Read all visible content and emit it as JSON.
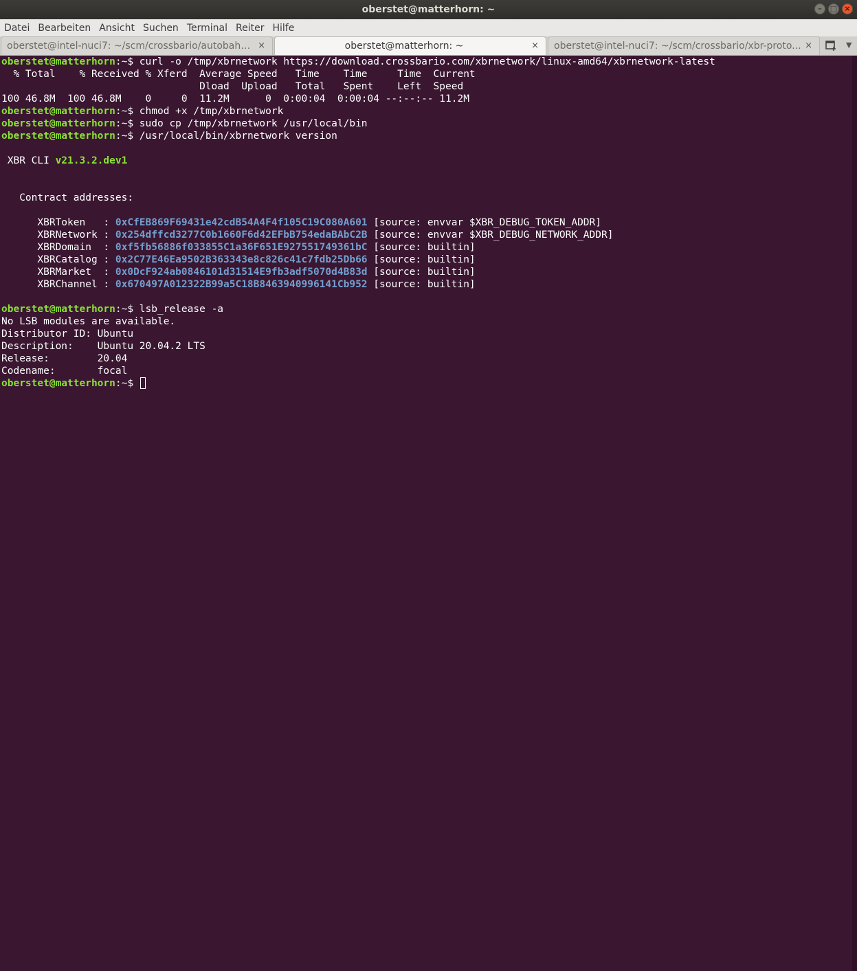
{
  "window": {
    "title": "oberstet@matterhorn: ~"
  },
  "menu": [
    "Datei",
    "Bearbeiten",
    "Ansicht",
    "Suchen",
    "Terminal",
    "Reiter",
    "Hilfe"
  ],
  "tabs": [
    {
      "label": "oberstet@intel-nuci7: ~/scm/crossbario/autobahn-...",
      "active": false
    },
    {
      "label": "oberstet@matterhorn: ~",
      "active": true
    },
    {
      "label": "oberstet@intel-nuci7: ~/scm/crossbario/xbr-proto...",
      "active": false
    }
  ],
  "prompt": {
    "user_host": "oberstet@matterhorn",
    "path_sym": ":~$"
  },
  "terminal": {
    "cmd1": " curl -o /tmp/xbrnetwork https://download.crossbario.com/xbrnetwork/linux-amd64/xbrnetwork-latest",
    "curl_h1": "  % Total    % Received % Xferd  Average Speed   Time    Time     Time  Current",
    "curl_h2": "                                 Dload  Upload   Total   Spent    Left  Speed",
    "curl_row": "100 46.8M  100 46.8M    0     0  11.2M      0  0:00:04  0:00:04 --:--:-- 11.2M",
    "cmd2": " chmod +x /tmp/xbrnetwork",
    "cmd3": " sudo cp /tmp/xbrnetwork /usr/local/bin",
    "cmd4": " /usr/local/bin/xbrnetwork version",
    "cli_prefix": " XBR CLI ",
    "cli_version": "v21.3.2.dev1",
    "contract_header": "   Contract addresses:",
    "contracts": [
      {
        "name": "      XBRToken   : ",
        "address": "0xCfEB869F69431e42cdB54A4F4f105C19C080A601",
        "source": " [source: envvar $XBR_DEBUG_TOKEN_ADDR]"
      },
      {
        "name": "      XBRNetwork : ",
        "address": "0x254dffcd3277C0b1660F6d42EFbB754edaBAbC2B",
        "source": " [source: envvar $XBR_DEBUG_NETWORK_ADDR]"
      },
      {
        "name": "      XBRDomain  : ",
        "address": "0xf5fb56886f033855C1a36F651E927551749361bC",
        "source": " [source: builtin]"
      },
      {
        "name": "      XBRCatalog : ",
        "address": "0x2C77E46Ea9502B363343e8c826c41c7fdb25Db66",
        "source": " [source: builtin]"
      },
      {
        "name": "      XBRMarket  : ",
        "address": "0x0DcF924ab0846101d31514E9fb3adf5070d4B83d",
        "source": " [source: builtin]"
      },
      {
        "name": "      XBRChannel : ",
        "address": "0x670497A012322B99a5C18B8463940996141Cb952",
        "source": " [source: builtin]"
      }
    ],
    "cmd5": " lsb_release -a",
    "lsb": [
      "No LSB modules are available.",
      "Distributor ID: Ubuntu",
      "Description:    Ubuntu 20.04.2 LTS",
      "Release:        20.04",
      "Codename:       focal"
    ]
  }
}
